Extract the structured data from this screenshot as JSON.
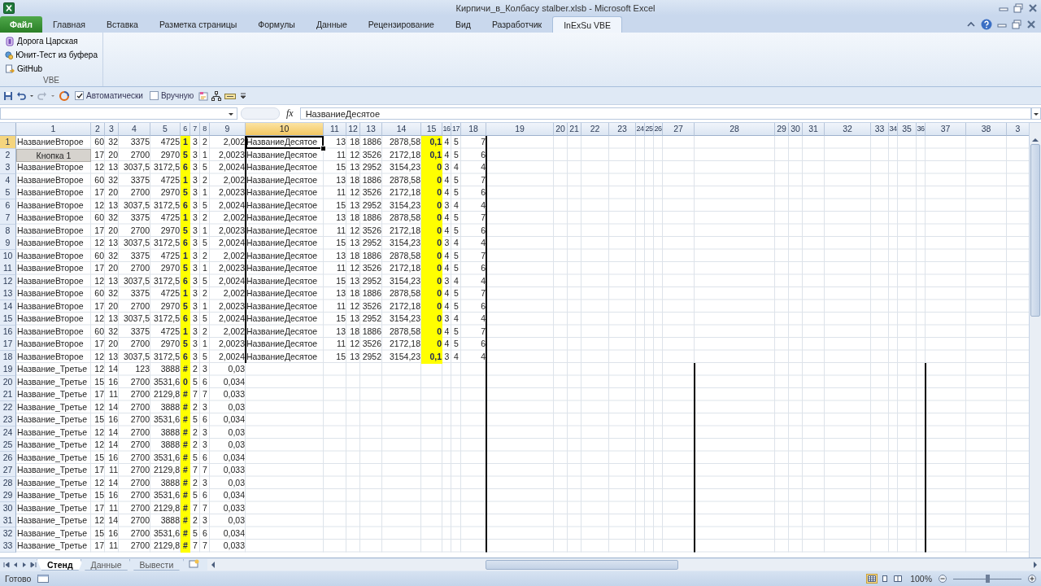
{
  "window": {
    "title": "Кирпичи_в_Колбасу stalber.xlsb  -  Microsoft Excel"
  },
  "ribbon_tabs": [
    {
      "label": "Файл",
      "kind": "file",
      "selected": false
    },
    {
      "label": "Главная",
      "kind": "tab",
      "selected": false
    },
    {
      "label": "Вставка",
      "kind": "tab",
      "selected": false
    },
    {
      "label": "Разметка страницы",
      "kind": "tab",
      "selected": false
    },
    {
      "label": "Формулы",
      "kind": "tab",
      "selected": false
    },
    {
      "label": "Данные",
      "kind": "tab",
      "selected": false
    },
    {
      "label": "Рецензирование",
      "kind": "tab",
      "selected": false
    },
    {
      "label": "Вид",
      "kind": "tab",
      "selected": false
    },
    {
      "label": "Разработчик",
      "kind": "tab",
      "selected": false
    },
    {
      "label": "InExSu VBE",
      "kind": "tab",
      "selected": true
    }
  ],
  "ribbon_group": {
    "label": "VBE",
    "items": [
      "Дорога Царская",
      "Юнит-Тест из буфера",
      "GitHub"
    ]
  },
  "quick_access": {
    "checkboxes": [
      {
        "label": "Автоматически",
        "checked": true
      },
      {
        "label": "Вручную",
        "checked": false
      }
    ]
  },
  "formula_bar": {
    "fx_label": "fx",
    "value": "НазваниеДесятое"
  },
  "sheet_button": {
    "label": "Кнопка 1"
  },
  "columns": [
    {
      "label": "1",
      "selected": false
    },
    {
      "label": "2",
      "selected": false
    },
    {
      "label": "3",
      "selected": false
    },
    {
      "label": "4",
      "selected": false
    },
    {
      "label": "5",
      "selected": false
    },
    {
      "label": "6",
      "selected": false
    },
    {
      "label": "7",
      "selected": false
    },
    {
      "label": "8",
      "selected": false
    },
    {
      "label": "9",
      "selected": false
    },
    {
      "label": "10",
      "selected": true
    },
    {
      "label": "11",
      "selected": false
    },
    {
      "label": "12",
      "selected": false
    },
    {
      "label": "13",
      "selected": false
    },
    {
      "label": "14",
      "selected": false
    },
    {
      "label": "15",
      "selected": false
    },
    {
      "label": "16",
      "selected": false
    },
    {
      "label": "17",
      "selected": false
    },
    {
      "label": "18",
      "selected": false
    },
    {
      "label": "19",
      "selected": false
    },
    {
      "label": "20",
      "selected": false
    },
    {
      "label": "21",
      "selected": false
    },
    {
      "label": "22",
      "selected": false
    },
    {
      "label": "23",
      "selected": false
    },
    {
      "label": "24",
      "selected": false
    },
    {
      "label": "25",
      "selected": false
    },
    {
      "label": "26",
      "selected": false
    },
    {
      "label": "27",
      "selected": false
    },
    {
      "label": "28",
      "selected": false
    },
    {
      "label": "29",
      "selected": false
    },
    {
      "label": "30",
      "selected": false
    },
    {
      "label": "31",
      "selected": false
    },
    {
      "label": "32",
      "selected": false
    },
    {
      "label": "33",
      "selected": false
    },
    {
      "label": "34",
      "selected": false
    },
    {
      "label": "35",
      "selected": false
    },
    {
      "label": "36",
      "selected": false
    },
    {
      "label": "37",
      "selected": false
    },
    {
      "label": "38",
      "selected": false
    },
    {
      "label": "3",
      "selected": false
    }
  ],
  "rows": [
    {
      "label": "1",
      "selected": true,
      "cells": [
        "НазваниеВторое",
        "60",
        "32",
        "3375",
        "4725",
        {
          "text": "1",
          "highlighted": true
        },
        "3",
        "2",
        "2,002",
        "НазваниеДесятое",
        "13",
        "18",
        "1886",
        "2878,58",
        {
          "text": "0,1",
          "highlighted": true
        },
        "4",
        "5",
        "7"
      ]
    },
    {
      "label": "2",
      "selected": false,
      "cells": [
        null,
        "17",
        "20",
        "2700",
        "2970",
        {
          "text": "5",
          "highlighted": true
        },
        "3",
        "1",
        "2,0023",
        "НазваниеДесятое",
        "11",
        "12",
        "3526",
        "2172,18",
        {
          "text": "0,1",
          "highlighted": true
        },
        "4",
        "5",
        "6"
      ]
    },
    {
      "label": "3",
      "selected": false,
      "cells": [
        "НазваниеВторое",
        "12",
        "13",
        "3037,5",
        "3172,5",
        {
          "text": "6",
          "highlighted": true
        },
        "3",
        "5",
        "2,0024",
        "НазваниеДесятое",
        "15",
        "13",
        "2952",
        "3154,23",
        {
          "text": "0",
          "highlighted": true
        },
        "3",
        "4",
        "4"
      ]
    },
    {
      "label": "4",
      "selected": false,
      "cells": [
        "НазваниеВторое",
        "60",
        "32",
        "3375",
        "4725",
        {
          "text": "1",
          "highlighted": true
        },
        "3",
        "2",
        "2,002",
        "НазваниеДесятое",
        "13",
        "18",
        "1886",
        "2878,58",
        {
          "text": "0",
          "highlighted": true
        },
        "4",
        "5",
        "7"
      ]
    },
    {
      "label": "5",
      "selected": false,
      "cells": [
        "НазваниеВторое",
        "17",
        "20",
        "2700",
        "2970",
        {
          "text": "5",
          "highlighted": true
        },
        "3",
        "1",
        "2,0023",
        "НазваниеДесятое",
        "11",
        "12",
        "3526",
        "2172,18",
        {
          "text": "0",
          "highlighted": true
        },
        "4",
        "5",
        "6"
      ]
    },
    {
      "label": "6",
      "selected": false,
      "cells": [
        "НазваниеВторое",
        "12",
        "13",
        "3037,5",
        "3172,5",
        {
          "text": "6",
          "highlighted": true
        },
        "3",
        "5",
        "2,0024",
        "НазваниеДесятое",
        "15",
        "13",
        "2952",
        "3154,23",
        {
          "text": "0",
          "highlighted": true
        },
        "3",
        "4",
        "4"
      ]
    },
    {
      "label": "7",
      "selected": false,
      "cells": [
        "НазваниеВторое",
        "60",
        "32",
        "3375",
        "4725",
        {
          "text": "1",
          "highlighted": true
        },
        "3",
        "2",
        "2,002",
        "НазваниеДесятое",
        "13",
        "18",
        "1886",
        "2878,58",
        {
          "text": "0",
          "highlighted": true
        },
        "4",
        "5",
        "7"
      ]
    },
    {
      "label": "8",
      "selected": false,
      "cells": [
        "НазваниеВторое",
        "17",
        "20",
        "2700",
        "2970",
        {
          "text": "5",
          "highlighted": true
        },
        "3",
        "1",
        "2,0023",
        "НазваниеДесятое",
        "11",
        "12",
        "3526",
        "2172,18",
        {
          "text": "0",
          "highlighted": true
        },
        "4",
        "5",
        "6"
      ]
    },
    {
      "label": "9",
      "selected": false,
      "cells": [
        "НазваниеВторое",
        "12",
        "13",
        "3037,5",
        "3172,5",
        {
          "text": "6",
          "highlighted": true
        },
        "3",
        "5",
        "2,0024",
        "НазваниеДесятое",
        "15",
        "13",
        "2952",
        "3154,23",
        {
          "text": "0",
          "highlighted": true
        },
        "3",
        "4",
        "4"
      ]
    },
    {
      "label": "10",
      "selected": false,
      "cells": [
        "НазваниеВторое",
        "60",
        "32",
        "3375",
        "4725",
        {
          "text": "1",
          "highlighted": true
        },
        "3",
        "2",
        "2,002",
        "НазваниеДесятое",
        "13",
        "18",
        "1886",
        "2878,58",
        {
          "text": "0",
          "highlighted": true
        },
        "4",
        "5",
        "7"
      ]
    },
    {
      "label": "11",
      "selected": false,
      "cells": [
        "НазваниеВторое",
        "17",
        "20",
        "2700",
        "2970",
        {
          "text": "5",
          "highlighted": true
        },
        "3",
        "1",
        "2,0023",
        "НазваниеДесятое",
        "11",
        "12",
        "3526",
        "2172,18",
        {
          "text": "0",
          "highlighted": true
        },
        "4",
        "5",
        "6"
      ]
    },
    {
      "label": "12",
      "selected": false,
      "cells": [
        "НазваниеВторое",
        "12",
        "13",
        "3037,5",
        "3172,5",
        {
          "text": "6",
          "highlighted": true
        },
        "3",
        "5",
        "2,0024",
        "НазваниеДесятое",
        "15",
        "13",
        "2952",
        "3154,23",
        {
          "text": "0",
          "highlighted": true
        },
        "3",
        "4",
        "4"
      ]
    },
    {
      "label": "13",
      "selected": false,
      "cells": [
        "НазваниеВторое",
        "60",
        "32",
        "3375",
        "4725",
        {
          "text": "1",
          "highlighted": true
        },
        "3",
        "2",
        "2,002",
        "НазваниеДесятое",
        "13",
        "18",
        "1886",
        "2878,58",
        {
          "text": "0",
          "highlighted": true
        },
        "4",
        "5",
        "7"
      ]
    },
    {
      "label": "14",
      "selected": false,
      "cells": [
        "НазваниеВторое",
        "17",
        "20",
        "2700",
        "2970",
        {
          "text": "5",
          "highlighted": true
        },
        "3",
        "1",
        "2,0023",
        "НазваниеДесятое",
        "11",
        "12",
        "3526",
        "2172,18",
        {
          "text": "0",
          "highlighted": true
        },
        "4",
        "5",
        "6"
      ]
    },
    {
      "label": "15",
      "selected": false,
      "cells": [
        "НазваниеВторое",
        "12",
        "13",
        "3037,5",
        "3172,5",
        {
          "text": "6",
          "highlighted": true
        },
        "3",
        "5",
        "2,0024",
        "НазваниеДесятое",
        "15",
        "13",
        "2952",
        "3154,23",
        {
          "text": "0",
          "highlighted": true
        },
        "3",
        "4",
        "4"
      ]
    },
    {
      "label": "16",
      "selected": false,
      "cells": [
        "НазваниеВторое",
        "60",
        "32",
        "3375",
        "4725",
        {
          "text": "1",
          "highlighted": true
        },
        "3",
        "2",
        "2,002",
        "НазваниеДесятое",
        "13",
        "18",
        "1886",
        "2878,58",
        {
          "text": "0",
          "highlighted": true
        },
        "4",
        "5",
        "7"
      ]
    },
    {
      "label": "17",
      "selected": false,
      "cells": [
        "НазваниеВторое",
        "17",
        "20",
        "2700",
        "2970",
        {
          "text": "5",
          "highlighted": true
        },
        "3",
        "1",
        "2,0023",
        "НазваниеДесятое",
        "11",
        "12",
        "3526",
        "2172,18",
        {
          "text": "0",
          "highlighted": true
        },
        "4",
        "5",
        "6"
      ]
    },
    {
      "label": "18",
      "selected": false,
      "cells": [
        "НазваниеВторое",
        "12",
        "13",
        "3037,5",
        "3172,5",
        {
          "text": "6",
          "highlighted": true
        },
        "3",
        "5",
        "2,0024",
        "НазваниеДесятое",
        "15",
        "13",
        "2952",
        "3154,23",
        {
          "text": "0,1",
          "highlighted": true
        },
        "3",
        "4",
        "4"
      ]
    },
    {
      "label": "19",
      "selected": false,
      "cells": [
        "Название_Третье",
        "12",
        "14",
        "123",
        "3888",
        {
          "text": "#",
          "highlighted": true
        },
        "2",
        "3",
        "0,03"
      ]
    },
    {
      "label": "20",
      "selected": false,
      "cells": [
        "Название_Третье",
        "15",
        "16",
        "2700",
        "3531,6",
        {
          "text": "0",
          "highlighted": true
        },
        "5",
        "6",
        "0,034"
      ]
    },
    {
      "label": "21",
      "selected": false,
      "cells": [
        "Название_Третье",
        "17",
        "11",
        "2700",
        "2129,8",
        {
          "text": "#",
          "highlighted": true
        },
        "7",
        "7",
        "0,033"
      ]
    },
    {
      "label": "22",
      "selected": false,
      "cells": [
        "Название_Третье",
        "12",
        "14",
        "2700",
        "3888",
        {
          "text": "#",
          "highlighted": true
        },
        "2",
        "3",
        "0,03"
      ]
    },
    {
      "label": "23",
      "selected": false,
      "cells": [
        "Название_Третье",
        "15",
        "16",
        "2700",
        "3531,6",
        {
          "text": "#",
          "highlighted": true
        },
        "5",
        "6",
        "0,034"
      ]
    },
    {
      "label": "24",
      "selected": false,
      "cells": [
        "Название_Третье",
        "12",
        "14",
        "2700",
        "3888",
        {
          "text": "#",
          "highlighted": true
        },
        "2",
        "3",
        "0,03"
      ]
    },
    {
      "label": "25",
      "selected": false,
      "cells": [
        "Название_Третье",
        "12",
        "14",
        "2700",
        "3888",
        {
          "text": "#",
          "highlighted": true
        },
        "2",
        "3",
        "0,03"
      ]
    },
    {
      "label": "26",
      "selected": false,
      "cells": [
        "Название_Третье",
        "15",
        "16",
        "2700",
        "3531,6",
        {
          "text": "#",
          "highlighted": true
        },
        "5",
        "6",
        "0,034"
      ]
    },
    {
      "label": "27",
      "selected": false,
      "cells": [
        "Название_Третье",
        "17",
        "11",
        "2700",
        "2129,8",
        {
          "text": "#",
          "highlighted": true
        },
        "7",
        "7",
        "0,033"
      ]
    },
    {
      "label": "28",
      "selected": false,
      "cells": [
        "Название_Третье",
        "12",
        "14",
        "2700",
        "3888",
        {
          "text": "#",
          "highlighted": true
        },
        "2",
        "3",
        "0,03"
      ]
    },
    {
      "label": "29",
      "selected": false,
      "cells": [
        "Название_Третье",
        "15",
        "16",
        "2700",
        "3531,6",
        {
          "text": "#",
          "highlighted": true
        },
        "5",
        "6",
        "0,034"
      ]
    },
    {
      "label": "30",
      "selected": false,
      "cells": [
        "Название_Третье",
        "17",
        "11",
        "2700",
        "2129,8",
        {
          "text": "#",
          "highlighted": true
        },
        "7",
        "7",
        "0,033"
      ]
    },
    {
      "label": "31",
      "selected": false,
      "cells": [
        "Название_Третье",
        "12",
        "14",
        "2700",
        "3888",
        {
          "text": "#",
          "highlighted": true
        },
        "2",
        "3",
        "0,03"
      ]
    },
    {
      "label": "32",
      "selected": false,
      "cells": [
        "Название_Третье",
        "15",
        "16",
        "2700",
        "3531,6",
        {
          "text": "#",
          "highlighted": true
        },
        "5",
        "6",
        "0,034"
      ]
    },
    {
      "label": "33",
      "selected": false,
      "cells": [
        "Название_Третье",
        "17",
        "11",
        "2700",
        "2129,8",
        {
          "text": "#",
          "highlighted": true
        },
        "7",
        "7",
        "0,033"
      ]
    }
  ],
  "sheet_tabs": [
    {
      "label": "Стенд",
      "selected": true
    },
    {
      "label": "Данные",
      "selected": false
    },
    {
      "label": "Вывести",
      "selected": false
    }
  ],
  "status_bar": {
    "text": "Готово",
    "view_buttons": [
      {
        "selected": true
      },
      {
        "selected": false
      },
      {
        "selected": false
      }
    ],
    "zoom": "100%",
    "zoom_slider": {
      "level": 0.5
    }
  }
}
